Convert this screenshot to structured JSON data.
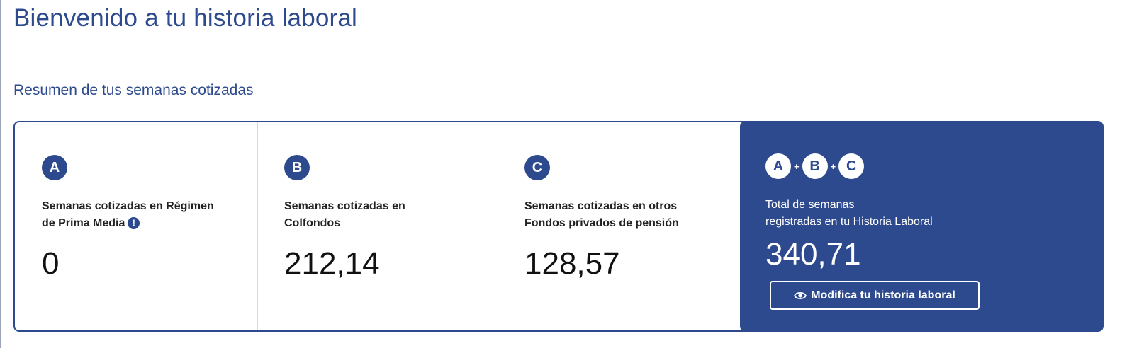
{
  "page": {
    "title": "Bienvenido a tu historia laboral",
    "section_title": "Resumen de tus semanas cotizadas"
  },
  "summary": {
    "columns": [
      {
        "letter": "A",
        "label_line1": "Semanas cotizadas en Régimen",
        "label_line2": "de Prima Media",
        "has_info_icon": true,
        "info_icon": "exclamation-info-icon",
        "value": "0"
      },
      {
        "letter": "B",
        "label_line1": "Semanas cotizadas en",
        "label_line2": "Colfondos",
        "value": "212,14"
      },
      {
        "letter": "C",
        "label_line1": "Semanas cotizadas en otros",
        "label_line2": "Fondos privados de pensión",
        "value": "128,57"
      }
    ],
    "total": {
      "formula": [
        "A",
        "+",
        "B",
        "+",
        "C"
      ],
      "label_line1": "Total de semanas",
      "label_line2": "registradas en tu Historia Laboral",
      "value": "340,71",
      "button_label": "Modifica tu historia laboral",
      "button_icon": "eye-icon"
    }
  },
  "info_icon_glyph": "!",
  "colors": {
    "brand_blue": "#2d4a8e",
    "white": "#ffffff",
    "divider": "#d9d9d9"
  }
}
